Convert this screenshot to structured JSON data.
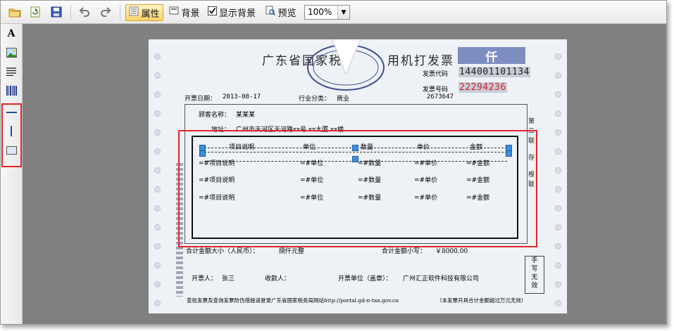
{
  "toolbar": {
    "properties_label": "属性",
    "background_label": "背景",
    "show_background_label": "显示背景",
    "preview_label": "预览",
    "zoom_value": "100%"
  },
  "invoice": {
    "title_left": "广东省国家税",
    "title_right": "用机打发票",
    "qian": "仟",
    "code_label": "发票代码",
    "code_value": "144001101134",
    "number_label": "发票号码",
    "number_value": "22294236",
    "date_label": "开票日期：",
    "date_value": "2013-08-17",
    "industry_label": "行业分类：",
    "industry_value": "商业",
    "serial": "2673647",
    "customer_label": "顾客名称：",
    "customer_value": "某某某",
    "address_label": "地址：",
    "address_value": "广州市天河区天河路xx号 xx大厦 xx楼",
    "columns": [
      "项目说明",
      "单位",
      "数量",
      "单价",
      "金额"
    ],
    "rows": [
      [
        "=#项目说明",
        "=#单位",
        "=#数量",
        "=#单价",
        "=#金额"
      ],
      [
        "=#项目说明",
        "=#单位",
        "=#数量",
        "=#单价",
        "=#金额"
      ],
      [
        "=#项目说明",
        "=#单位",
        "=#数量",
        "=#单价",
        "=#金额"
      ]
    ],
    "total_upper_label": "合计金额大小（人民币）：",
    "total_upper_value": "捌仟元整",
    "total_lower_label": "合计金额小写：",
    "total_lower_value": "￥8000.00",
    "payee_label": "开票人：",
    "payee_value": "张三",
    "receiver_label": "收款人：",
    "issuer_label": "开票单位（盖章）：",
    "issuer_value": "广州汇正软件科技有限公司",
    "footer_note": "查验发票及查询发票防伪措施请登录广东省国家税务局网站http://portal.gd-n-tax.gov.cn",
    "footer_right": "（本发票开具合计金额超过万元无效）",
    "side_right": [
      "第",
      "二",
      "联",
      "存",
      "根",
      "联"
    ],
    "side_right_bottom": [
      "手",
      "写",
      "无",
      "效"
    ]
  },
  "colors": {
    "selection": "#e0262b",
    "handle": "#3a8fe0",
    "number_red": "#d0202a"
  }
}
